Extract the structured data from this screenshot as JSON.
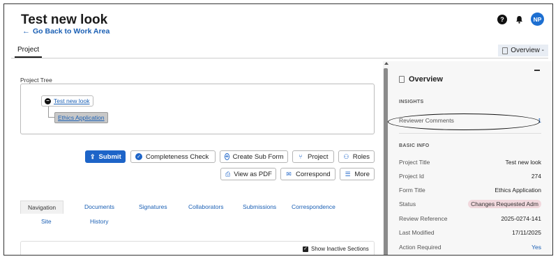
{
  "header": {
    "title": "Test new look",
    "back_label": "Go Back to Work Area",
    "help_symbol": "?",
    "avatar_initials": "NP"
  },
  "tabs": {
    "project_label": "Project",
    "overview_label": "Overview -"
  },
  "tree": {
    "label": "Project Tree",
    "root": "Test new look",
    "child": "Ethics Application"
  },
  "actions": {
    "submit": "Submit",
    "completeness_check": "Completeness Check",
    "create_sub_form": "Create Sub Form",
    "project": "Project",
    "roles": "Roles",
    "view_as_pdf": "View as PDF",
    "correspond": "Correspond",
    "more": "More"
  },
  "nav_tabs": {
    "navigation": "Navigation",
    "documents": "Documents",
    "signatures": "Signatures",
    "collaborators": "Collaborators",
    "submissions": "Submissions",
    "correspondence": "Correspondence",
    "site": "Site",
    "history": "History"
  },
  "sections": {
    "show_inactive_label": "Show Inactive Sections",
    "show_inactive_checked": true
  },
  "panel": {
    "title": "Overview",
    "insights_title": "INSIGHTS",
    "reviewer_comments_label": "Reviewer Comments",
    "reviewer_comments_count": "1",
    "basic_info_title": "BASIC INFO",
    "fields": {
      "project_title": {
        "label": "Project Title",
        "value": "Test new look"
      },
      "project_id": {
        "label": "Project Id",
        "value": "274"
      },
      "form_title": {
        "label": "Form Title",
        "value": "Ethics Application"
      },
      "status": {
        "label": "Status",
        "value": "Changes Requested Adm"
      },
      "review_reference": {
        "label": "Review Reference",
        "value": "2025-0274-141"
      },
      "last_modified": {
        "label": "Last Modified",
        "value": "17/11/2025"
      },
      "action_required": {
        "label": "Action Required",
        "value": "Yes"
      }
    }
  },
  "colors": {
    "accent": "#1d64c8",
    "link": "#1a5fb4",
    "status_pill": "#f1d8dd"
  }
}
